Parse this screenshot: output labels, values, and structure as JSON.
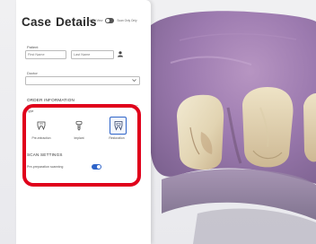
{
  "case_details": {
    "title_word1": "Case",
    "title_word2": "Details",
    "toggle_label_1": "Model View",
    "toggle_label_2": "Scan Only Only"
  },
  "patient": {
    "label": "Patient",
    "first_name_placeholder": "First Name",
    "last_name_placeholder": "Last Name"
  },
  "doctor": {
    "label": "Doctor"
  },
  "order_information": {
    "heading": "ORDER INFORMATION",
    "sub_label": "Type",
    "options": [
      {
        "label": "Pre-extraction",
        "icon": "tooth-extraction-icon",
        "selected": false
      },
      {
        "label": "Implant",
        "icon": "implant-icon",
        "selected": false
      },
      {
        "label": "Restoration",
        "icon": "restoration-icon",
        "selected": true
      }
    ]
  },
  "scan_settings": {
    "heading": "SCAN SETTINGS",
    "pre_prep_label": "Pre-preparation scanning",
    "pre_prep_enabled": true
  },
  "colors": {
    "accent": "#2e64c9",
    "highlight": "#e0001b",
    "gingiva": "#9c7fae",
    "tooth": "#e6dcc0"
  }
}
